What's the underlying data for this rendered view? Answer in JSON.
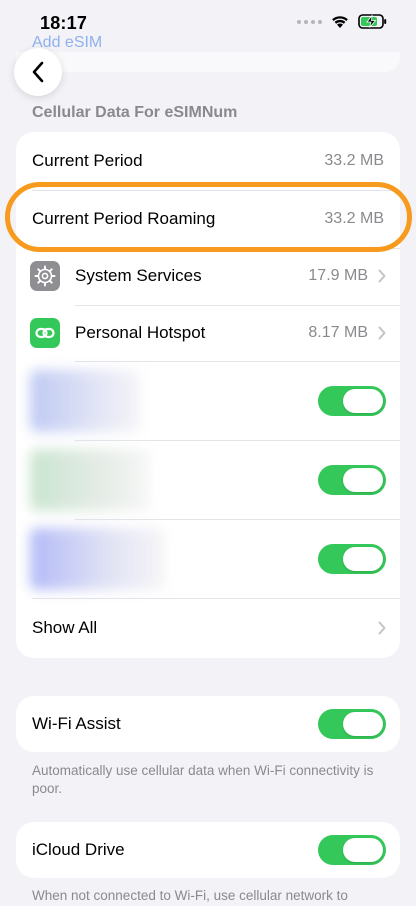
{
  "status_bar": {
    "time": "18:17"
  },
  "nav": {
    "top_link": "Add eSIM",
    "back_label": "‹"
  },
  "section": {
    "header": "Cellular Data For eSIMNum"
  },
  "usage_rows": [
    {
      "label": "Current Period",
      "value": "33.2 MB"
    },
    {
      "label": "Current Period Roaming",
      "value": "33.2 MB"
    },
    {
      "label": "System Services",
      "value": "17.9 MB"
    },
    {
      "label": "Personal Hotspot",
      "value": "8.17 MB"
    }
  ],
  "blurred_apps": [
    {
      "enabled": true,
      "tint": "#aab8f0"
    },
    {
      "enabled": true,
      "tint": "#b8dcc0"
    },
    {
      "enabled": true,
      "tint": "#9aa4f4"
    }
  ],
  "show_all": {
    "label": "Show All"
  },
  "wifi_assist": {
    "label": "Wi-Fi Assist",
    "enabled": true,
    "footnote": "Automatically use cellular data when Wi-Fi connectivity is poor."
  },
  "icloud_drive": {
    "label": "iCloud Drive",
    "enabled": true,
    "footnote": "When not connected to Wi-Fi, use cellular network to"
  },
  "colors": {
    "accent_green": "#34c759",
    "highlight_orange": "#f79a1e",
    "link_blue": "#8fb1ee"
  }
}
